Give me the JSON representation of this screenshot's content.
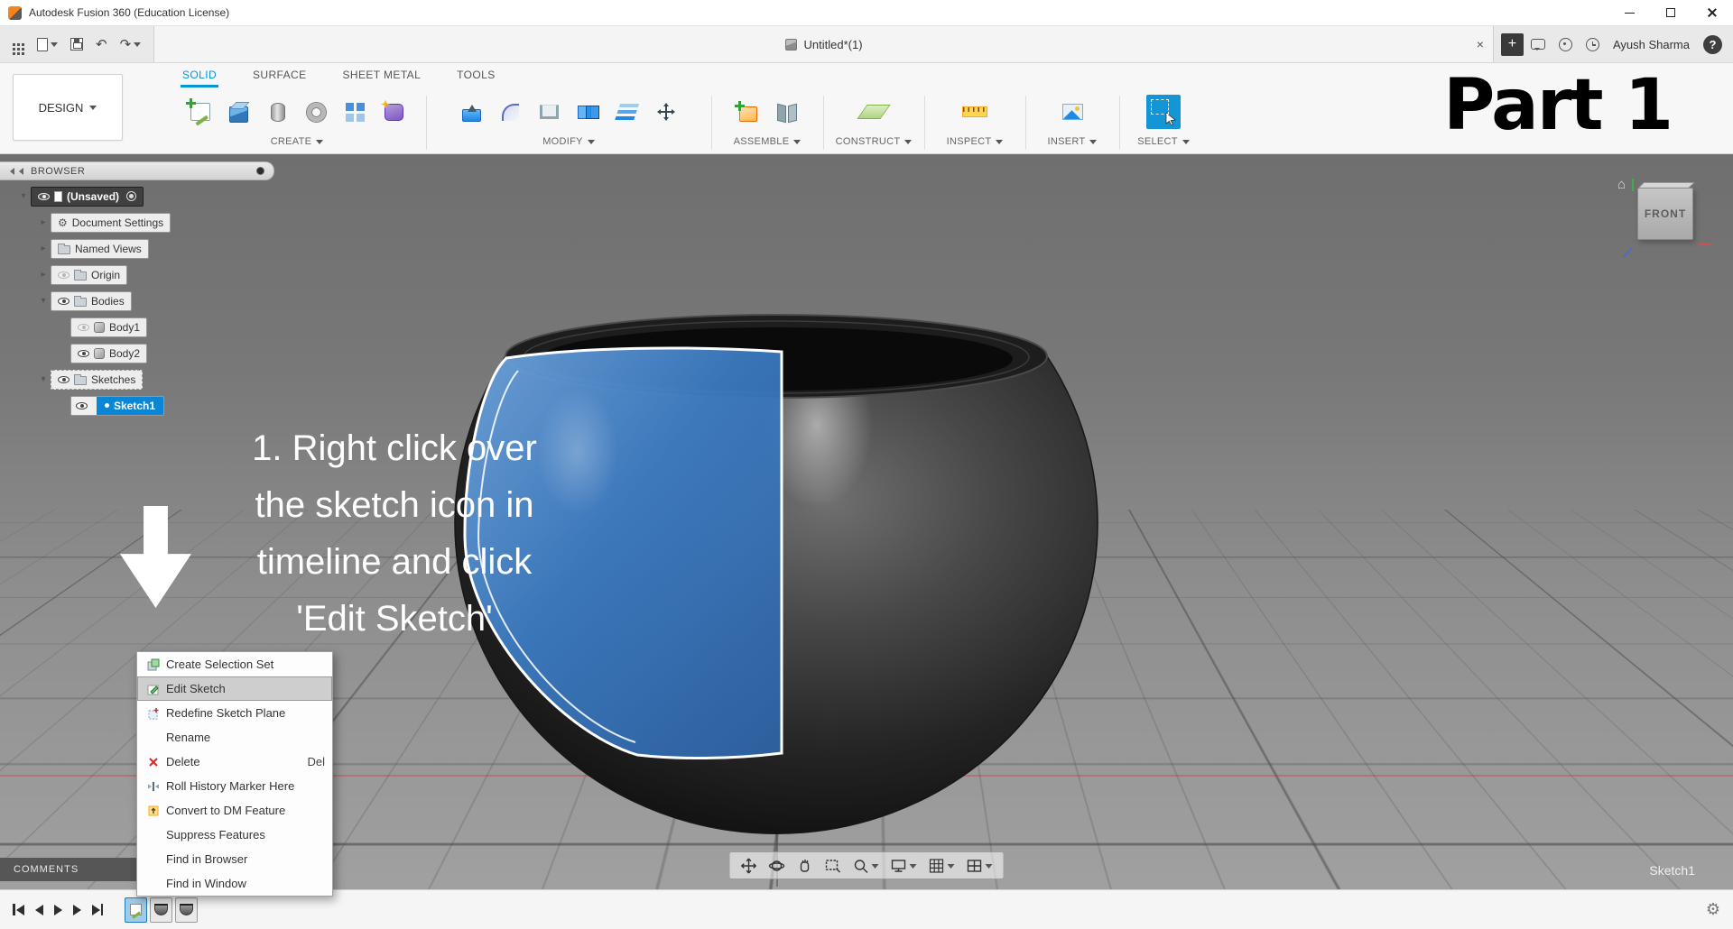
{
  "window": {
    "title": "Autodesk Fusion 360 (Education License)"
  },
  "tab_bar": {
    "document_tab": "Untitled*(1)",
    "user_name": "Ayush Sharma"
  },
  "ribbon": {
    "design_label": "DESIGN",
    "tabs": [
      {
        "label": "SOLID",
        "active": true
      },
      {
        "label": "SURFACE",
        "active": false
      },
      {
        "label": "SHEET METAL",
        "active": false
      },
      {
        "label": "TOOLS",
        "active": false
      }
    ],
    "groups": [
      {
        "label": "CREATE"
      },
      {
        "label": "MODIFY"
      },
      {
        "label": "ASSEMBLE"
      },
      {
        "label": "CONSTRUCT"
      },
      {
        "label": "INSPECT"
      },
      {
        "label": "INSERT"
      },
      {
        "label": "SELECT"
      }
    ]
  },
  "overlay": {
    "part_label": "Part 1"
  },
  "browser": {
    "header": "BROWSER",
    "items": [
      {
        "label": "(Unsaved)"
      },
      {
        "label": "Document Settings"
      },
      {
        "label": "Named Views"
      },
      {
        "label": "Origin"
      },
      {
        "label": "Bodies"
      },
      {
        "label": "Body1"
      },
      {
        "label": "Body2"
      },
      {
        "label": "Sketches"
      },
      {
        "label": "Sketch1"
      }
    ]
  },
  "annotation": {
    "line1": "1. Right click over",
    "line2": "the sketch icon in",
    "line3": "timeline and click",
    "line4": "'Edit Sketch'"
  },
  "context_menu": {
    "items": [
      {
        "label": "Create Selection Set"
      },
      {
        "label": "Edit Sketch",
        "highlighted": true
      },
      {
        "label": "Redefine Sketch Plane"
      },
      {
        "label": "Rename"
      },
      {
        "label": "Delete",
        "shortcut": "Del"
      },
      {
        "label": "Roll History Marker Here"
      },
      {
        "label": "Convert to DM Feature"
      },
      {
        "label": "Suppress Features"
      },
      {
        "label": "Find in Browser"
      },
      {
        "label": "Find in Window"
      }
    ]
  },
  "comments_panel": {
    "label": "COMMENTS"
  },
  "viewcube": {
    "front_label": "FRONT"
  },
  "canvas": {
    "active_sketch_label": "Sketch1"
  },
  "icons": {
    "undo": "↶",
    "redo": "↷",
    "close": "×",
    "new_tab": "+",
    "help": "?",
    "gear": "⚙",
    "home": "⌂",
    "caret_expanded": "▾",
    "caret_collapsed": "▸"
  },
  "colors": {
    "accent_blue": "#0696d7",
    "sketch_fill": "#3c7cc4",
    "canvas_top": "#6f6f6f",
    "canvas_bottom": "#a3a3a3"
  }
}
